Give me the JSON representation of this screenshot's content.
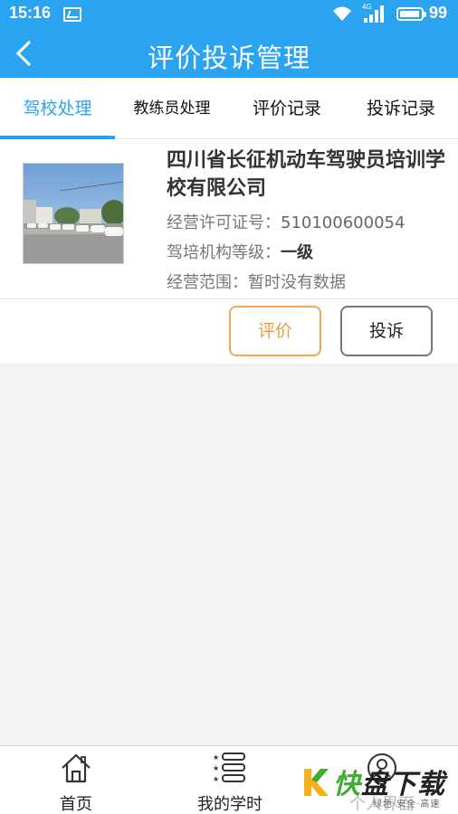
{
  "status_bar": {
    "time": "15:16",
    "network_label": "4G",
    "battery": "99"
  },
  "title_bar": {
    "title": "评价投诉管理"
  },
  "tabs": [
    {
      "label": "驾校处理",
      "active": true
    },
    {
      "label": "教练员处理",
      "active": false
    },
    {
      "label": "评价记录",
      "active": false
    },
    {
      "label": "投诉记录",
      "active": false
    }
  ],
  "school": {
    "name": "四川省长征机动车驾驶员培训学校有限公司",
    "license_label": "经营许可证号：",
    "license_value": "510100600054",
    "level_label": "驾培机构等级：",
    "level_value": "一级",
    "scope_label": "经营范围：",
    "scope_value": "暂时没有数据"
  },
  "actions": {
    "evaluate": "评价",
    "complain": "投诉"
  },
  "bottom_nav": [
    {
      "label": "首页",
      "icon": "home-icon"
    },
    {
      "label": "我的学时",
      "icon": "list-icon"
    },
    {
      "label": "个人界面",
      "icon": "user-icon"
    }
  ],
  "watermark": {
    "main_green": "快",
    "main_dark": "盘下载",
    "sub": "绿色·安全·高速"
  },
  "colors": {
    "primary": "#2aa3f0",
    "evaluate": "#ef9b3c",
    "watermark_green": "#3cae2c"
  }
}
